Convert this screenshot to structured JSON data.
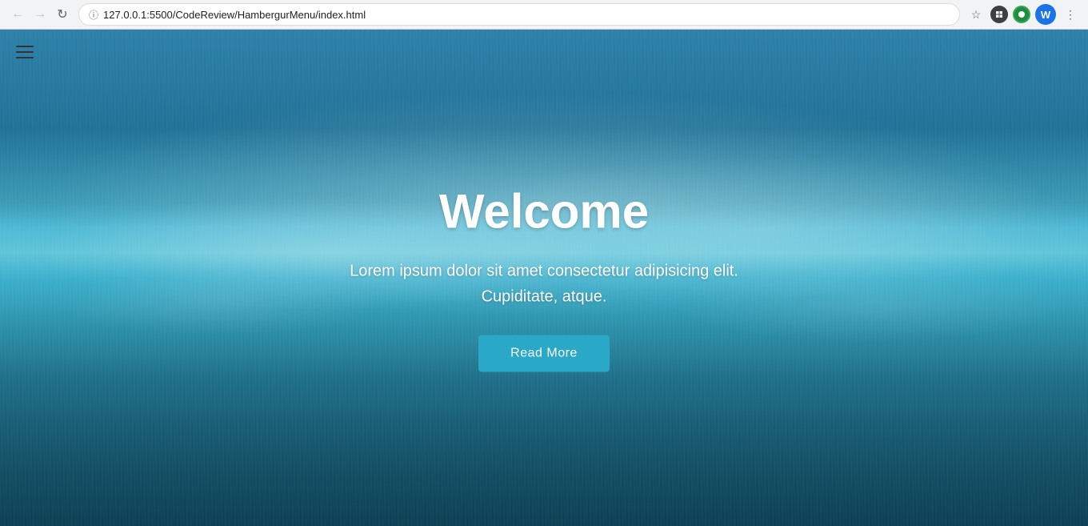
{
  "browser": {
    "url": "127.0.0.1:5500/CodeReview/HambergurMenu/index.html",
    "url_full": "127.0.0.1:5500/CodeReview/HambergurMenu/index.html",
    "lock_icon": "🔒",
    "back_icon": "←",
    "forward_icon": "→",
    "reload_icon": "↻",
    "star_icon": "☆",
    "menu_icon": "⋮",
    "profile_label": "W"
  },
  "navbar": {
    "hamburger_label": "hamburger menu"
  },
  "hero": {
    "title": "Welcome",
    "subtitle_line1": "Lorem ipsum dolor sit amet consectetur adipisicing elit.",
    "subtitle_line2": "Cupiditate, atque.",
    "button_label": "Read More"
  }
}
